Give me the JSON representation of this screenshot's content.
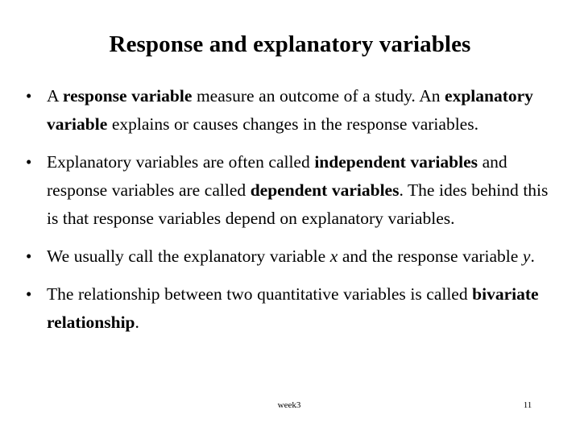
{
  "slide": {
    "title": "Response and explanatory variables",
    "bullet_marker": "•",
    "bullets": [
      {
        "id": "bullet-response-explanatory-definition",
        "plain_text": "A response variable measure an outcome of a study. An explanatory variable explains or causes changes in the response variables.",
        "runs": [
          {
            "text": "A ",
            "style": "normal"
          },
          {
            "text": "response variable",
            "style": "bold"
          },
          {
            "text": " measure an outcome of a study. An ",
            "style": "normal"
          },
          {
            "text": "explanatory variable",
            "style": "bold"
          },
          {
            "text": " explains or causes changes in the response variables.",
            "style": "normal"
          }
        ]
      },
      {
        "id": "bullet-independent-dependent",
        "plain_text": "Explanatory variables are often called independent variables and response variables are called dependent variables. The ides behind this is that response variables depend on explanatory variables.",
        "runs": [
          {
            "text": "Explanatory variables are often called ",
            "style": "normal"
          },
          {
            "text": "independent variables",
            "style": "bold"
          },
          {
            "text": " and response variables are called ",
            "style": "normal"
          },
          {
            "text": "dependent variables",
            "style": "bold"
          },
          {
            "text": ". The ides behind this is that response variables depend on explanatory variables.",
            "style": "normal"
          }
        ]
      },
      {
        "id": "bullet-x-y-notation",
        "plain_text": "We usually call the explanatory variable x and the response variable y.",
        "runs": [
          {
            "text": "We usually call the explanatory variable ",
            "style": "normal"
          },
          {
            "text": "x",
            "style": "italic"
          },
          {
            "text": " and the response variable ",
            "style": "normal"
          },
          {
            "text": "y",
            "style": "italic"
          },
          {
            "text": ".",
            "style": "normal"
          }
        ]
      },
      {
        "id": "bullet-bivariate-relationship",
        "plain_text": "The relationship between two quantitative variables is called bivariate relationship.",
        "runs": [
          {
            "text": "The relationship between two quantitative variables is called ",
            "style": "normal"
          },
          {
            "text": "bivariate relationship",
            "style": "bold"
          },
          {
            "text": ".",
            "style": "normal"
          }
        ]
      }
    ]
  },
  "footer": {
    "center_label": "week3",
    "page_number": "11"
  },
  "colors": {
    "background": "#ffffff",
    "text": "#000000"
  }
}
